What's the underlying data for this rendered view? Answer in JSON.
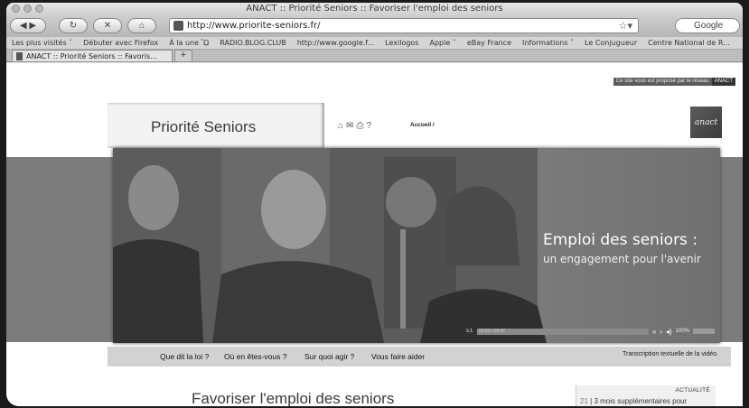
{
  "window": {
    "title": "ANACT :: Priorité Seniors :: Favoriser l'emploi des seniors"
  },
  "toolbar": {
    "url": "http://www.priorite-seniors.fr/",
    "search_placeholder": "Google"
  },
  "bookmarks": [
    "Les plus visités ˇ",
    "Débuter avec Firefox",
    "À la une ᾪ",
    "RADIO.BLOG.CLUB",
    "http://www.google.f...",
    "Lexilogos",
    "Apple ˇ",
    "eBay France",
    "Informations ˇ",
    "Le Conjugueur",
    "Centre National de R..."
  ],
  "tab": {
    "label": "ANACT :: Priorité Seniors :: Favoris...",
    "new_tab": "+"
  },
  "page": {
    "reseau_text": "Ce site vous est proposé par le réseau",
    "reseau_brand": "ANACT",
    "site_title": "Priorité Seniors",
    "accueil": "Accueil /",
    "logo_text": "anact",
    "hero": {
      "title": "Emploi des seniors :",
      "subtitle": "un engagement pour l'avenir",
      "player_st": "s.t.",
      "player_time": "00:00 / 00:47",
      "player_zoom": "100%"
    },
    "nav": [
      "Que dit la loi ?",
      "Où en êtes-vous ?",
      "Sur quoi agir ?",
      "Vous faire aider"
    ],
    "transcript": "Transcription textuelle de la vidéo.",
    "main_heading": "Favoriser l'emploi des seniors",
    "actualite": {
      "label": "ACTUALITÉ",
      "item_num": "21",
      "item_text": "3 mois supplémentaires pour"
    }
  }
}
